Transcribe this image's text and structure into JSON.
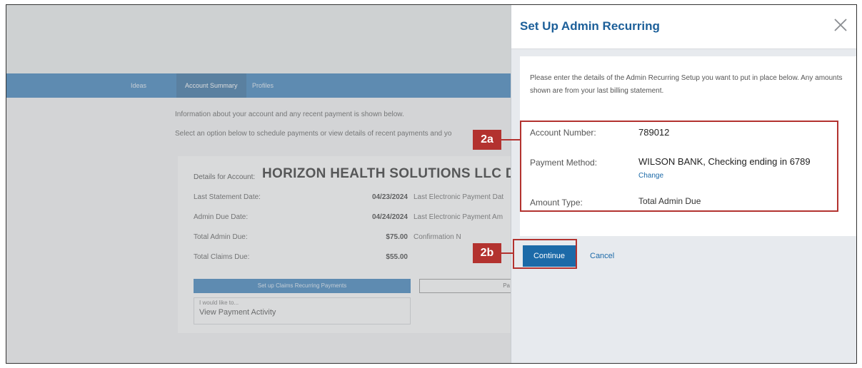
{
  "background": {
    "nav": {
      "items": [
        "Ideas",
        "Account Summary",
        "Profiles"
      ]
    },
    "info_line_1": "Information about your account and any recent payment is shown below.",
    "info_line_2": "Select an option below to schedule payments or view details of recent payments and yo",
    "details_label": "Details for Account:",
    "company_name": "HORIZON HEALTH SOLUTIONS LLC DCA I",
    "rows": [
      {
        "label": "Last Statement Date:",
        "value": "04/23/2024",
        "right": "Last Electronic Payment Dat"
      },
      {
        "label": "Admin Due Date:",
        "value": "04/24/2024",
        "right": "Last Electronic Payment Am"
      },
      {
        "label": "Total Admin Due:",
        "value": "$75.00",
        "right": "Confirmation N"
      },
      {
        "label": "Total Claims Due:",
        "value": "$55.00",
        "right": ""
      }
    ],
    "claims_button": "Set up Claims Recurring Payments",
    "other_button": "Pa",
    "select_small_label": "I would like to...",
    "select_value": "View Payment Activity"
  },
  "panel": {
    "title": "Set Up Admin Recurring",
    "intro": "Please enter the details of the Admin Recurring Setup you want to put in place below. Any amounts shown are from your last billing statement.",
    "fields": {
      "account_number_label": "Account Number:",
      "account_number_value": "789012",
      "payment_method_label": "Payment Method:",
      "payment_method_value": "WILSON BANK, Checking ending in 6789",
      "change_link": "Change",
      "amount_type_label": "Amount Type:",
      "amount_type_value": "Total Admin Due"
    },
    "continue_label": "Continue",
    "cancel_label": "Cancel"
  },
  "annotations": {
    "badge_2a": "2a",
    "badge_2b": "2b",
    "color": "#b3322f"
  },
  "colors": {
    "nav_blue": "#1f6fb2",
    "title_blue": "#1c5f99",
    "button_blue": "#1c6aa8"
  },
  "icons": {
    "close": "close-icon"
  }
}
